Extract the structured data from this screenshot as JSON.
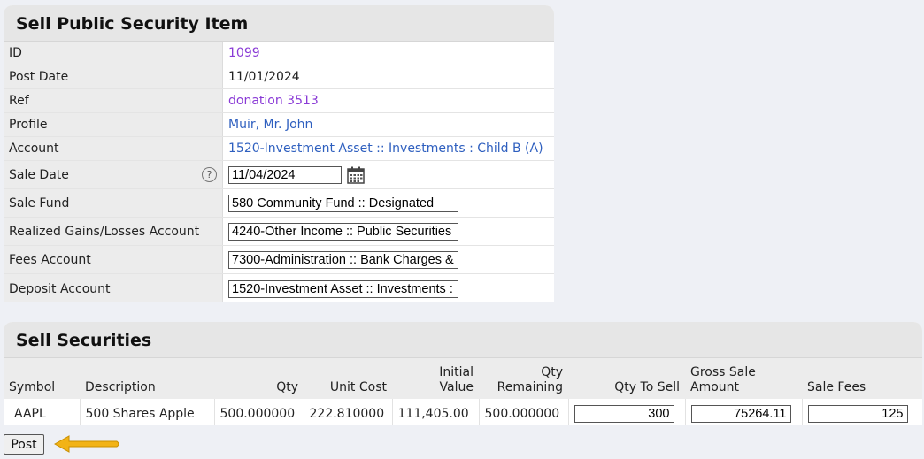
{
  "item_panel": {
    "title": "Sell Public Security Item",
    "rows": [
      {
        "label": "ID",
        "value": "1099"
      },
      {
        "label": "Post Date",
        "value": "11/01/2024"
      },
      {
        "label": "Ref",
        "value": "donation 3513"
      },
      {
        "label": "Profile",
        "value": "Muir, Mr. John"
      },
      {
        "label": "Account",
        "value": "1520-Investment Asset :: Investments : Child B (A)"
      },
      {
        "label": "Sale Date",
        "value": "11/04/2024"
      },
      {
        "label": "Sale Fund",
        "value": "580 Community Fund :: Designated"
      },
      {
        "label": "Realized Gains/Losses Account",
        "value": "4240-Other Income :: Public Securities"
      },
      {
        "label": "Fees Account",
        "value": "7300-Administration :: Bank Charges &"
      },
      {
        "label": "Deposit Account",
        "value": "1520-Investment Asset :: Investments :"
      }
    ],
    "help_glyph": "?",
    "colors": {
      "purple_link": "#8a3bd6",
      "blue_link": "#2e5fbf"
    }
  },
  "securities_panel": {
    "title": "Sell Securities",
    "headers": {
      "symbol": "Symbol",
      "description": "Description",
      "qty": "Qty",
      "unit_cost": "Unit Cost",
      "initial_value_1": "Initial",
      "initial_value_2": "Value",
      "qty_remaining_1": "Qty",
      "qty_remaining_2": "Remaining",
      "qty_to_sell": "Qty To Sell",
      "gross_sale_1": "Gross Sale",
      "gross_sale_2": "Amount",
      "sale_fees": "Sale Fees"
    },
    "rows": [
      {
        "symbol": "AAPL",
        "description": "500 Shares Apple",
        "qty": "500.000000",
        "unit_cost": "222.810000",
        "initial_value": "111,405.00",
        "qty_remaining": "500.000000",
        "qty_to_sell": "300",
        "gross_sale_amount": "75264.11",
        "sale_fees": "125"
      }
    ]
  },
  "post_button": "Post",
  "arrow_color": "#f2b316"
}
